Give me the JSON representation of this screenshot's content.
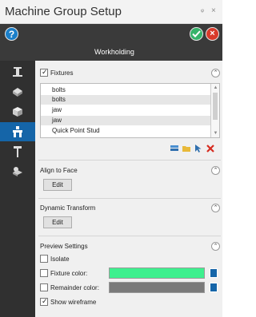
{
  "window": {
    "title": "Machine Group Setup",
    "pin_glyph": "ᵠ",
    "close_glyph": "×"
  },
  "header": {
    "heading": "Workholding",
    "help_glyph": "?",
    "cancel_glyph": "×"
  },
  "fixtures": {
    "label": "Fixtures",
    "checked": true,
    "items": [
      "bolts",
      "bolts",
      "jaw",
      "jaw",
      "Quick Point Stud"
    ]
  },
  "align": {
    "label": "Align to Face",
    "button": "Edit"
  },
  "dynamic": {
    "label": "Dynamic Transform",
    "button": "Edit"
  },
  "preview": {
    "label": "Preview Settings",
    "isolate": "Isolate",
    "fixture_color": "Fixture color:",
    "remainder_color": "Remainder color:",
    "show_wireframe": "Show wireframe",
    "fixture_swatch": "#3ef08e",
    "remainder_swatch": "#7a7a7a"
  },
  "colors": {
    "accent": "#1565a8",
    "header": "#3a3a3a",
    "sidebar": "#303030"
  }
}
